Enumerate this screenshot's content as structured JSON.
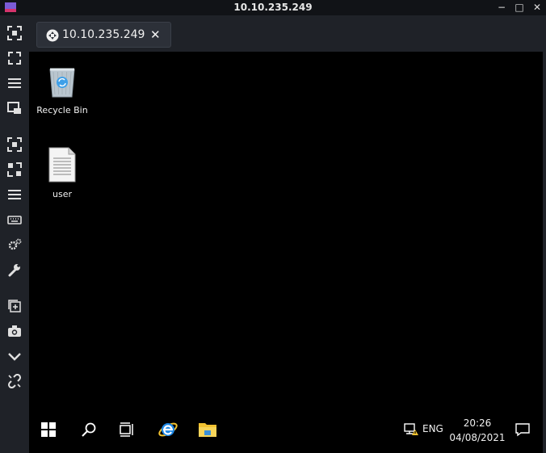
{
  "window": {
    "title": "10.10.235.249",
    "minimize_glyph": "−",
    "maximize_glyph": "□",
    "close_glyph": "✕"
  },
  "tab": {
    "label": "10.10.235.249",
    "close_glyph": "✕",
    "icon": "remote-desktop-icon"
  },
  "sidebar": {
    "items": [
      {
        "name": "fit-screen-icon"
      },
      {
        "name": "fullscreen-icon"
      },
      {
        "name": "menu-lines-icon"
      },
      {
        "name": "window-stack-icon"
      },
      {
        "name": "fit-screen-icon-2"
      },
      {
        "name": "fullscreen-icon-2"
      },
      {
        "name": "menu-lines-icon-2"
      },
      {
        "name": "keyboard-icon"
      },
      {
        "name": "settings-gears-icon"
      },
      {
        "name": "wrench-icon"
      },
      {
        "name": "new-window-icon"
      },
      {
        "name": "camera-icon"
      },
      {
        "name": "chevron-down-icon"
      },
      {
        "name": "disconnect-link-icon"
      }
    ]
  },
  "desktop": {
    "icons": [
      {
        "label": "Recycle Bin",
        "icon": "recycle-bin-icon"
      },
      {
        "label": "user",
        "icon": "document-icon"
      }
    ]
  },
  "taskbar": {
    "items": [
      "windows-start-icon",
      "search-icon",
      "task-view-icon",
      "internet-explorer-icon",
      "file-explorer-icon"
    ],
    "tray": {
      "language": "ENG",
      "time": "20:26",
      "date": "04/08/2021",
      "network_icon": "network-warning-icon",
      "notification_icon": "action-center-icon"
    }
  },
  "colors": {
    "chrome_bg": "#1f2228",
    "titlebar_bg": "#111317",
    "desktop_bg": "#000000",
    "ie_blue": "#1e88e5",
    "folder_yellow": "#f2c230",
    "recycle_blue": "#3fa0e8"
  }
}
